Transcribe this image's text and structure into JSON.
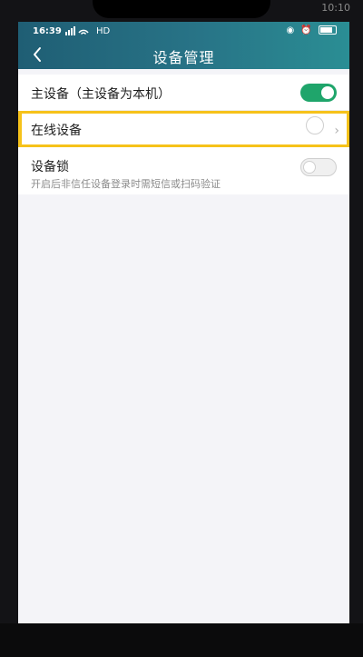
{
  "hardware": {
    "left_text": "▮ ◠",
    "clock": "10:10"
  },
  "status_bar": {
    "time": "16:39",
    "network": "HD",
    "signal_icon": "signal-icon",
    "wifi_icon": "wifi-icon",
    "battery_icon": "battery-icon"
  },
  "header": {
    "title": "设备管理",
    "back_icon": "chevron-left-icon",
    "gradient": [
      "#1f5e74",
      "#2a8e94"
    ]
  },
  "settings": {
    "primary_device": {
      "label": "主设备（主设备为本机）",
      "enabled": true
    },
    "online_devices": {
      "label": "在线设备",
      "highlight_color": "#f6c21a"
    },
    "device_lock": {
      "label": "设备锁",
      "subtitle": "开启后非信任设备登录时需短信或扫码验证",
      "enabled": false
    }
  },
  "colors": {
    "toggle_on": "#1fa56b",
    "background": "#f4f4f8"
  }
}
